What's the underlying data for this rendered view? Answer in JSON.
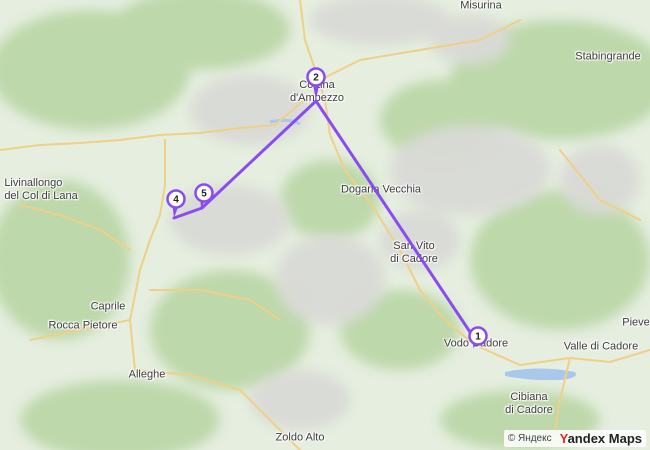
{
  "map": {
    "route_color": "#8a4cf0",
    "waypoints": [
      {
        "number": "1"
      },
      {
        "number": "2"
      },
      {
        "number": "4"
      },
      {
        "number": "5"
      }
    ],
    "labels": {
      "misurina": "Misurina",
      "stabingrande": "Stabingrande",
      "cortina_line1": "Cortina",
      "cortina_line2": "d'Ampezzo",
      "livinallongo_line1": "Livinallongo",
      "livinallongo_line2": "del Col di Lana",
      "dogana": "Dogana Vecchia",
      "sanvito_line1": "San Vito",
      "sanvito_line2": "di Cadore",
      "caprile": "Caprile",
      "rocca": "Rocca Pietore",
      "pieve": "Pieve",
      "vodo": "Vodo Cadore",
      "valle": "Valle di Cadore",
      "alleghe": "Alleghe",
      "cibiana_line1": "Cibiana",
      "cibiana_line2": "di Cadore",
      "zoldo": "Zoldo Alto"
    },
    "attribution": {
      "copyright": "© Яндекс",
      "brand_y": "Y",
      "brand_rest": "andex Maps"
    }
  }
}
